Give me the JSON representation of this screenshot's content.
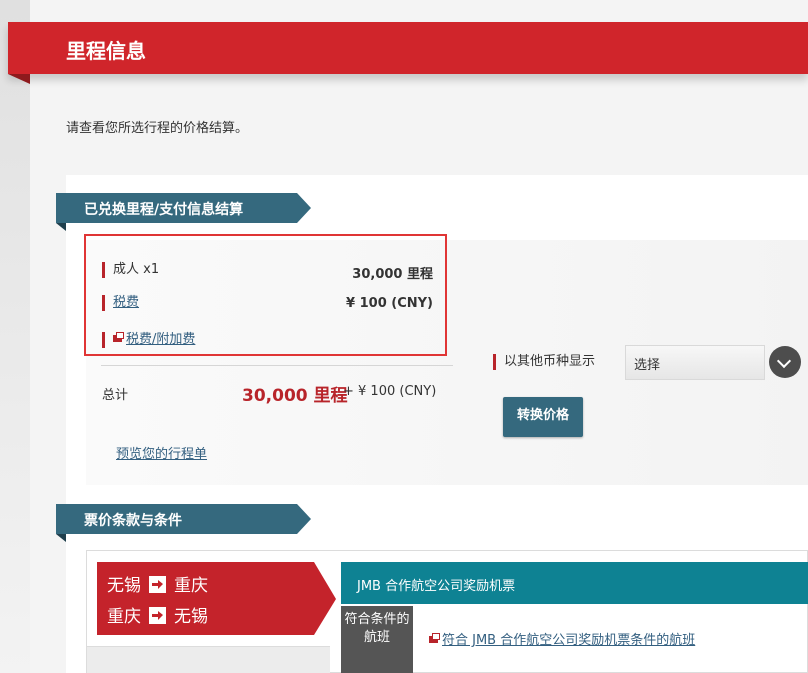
{
  "header": {
    "title": "里程信息"
  },
  "intro_text": "请查看您所选行程的价格结算。",
  "summary": {
    "section_title": "已兑换里程/支付信息结算",
    "rows": [
      {
        "label": "成人 x1",
        "value": "30,000 里程"
      },
      {
        "label": "税费",
        "value": "¥ 100 (CNY)"
      },
      {
        "label": "税费/附加费",
        "value": ""
      }
    ],
    "total_label": "总计",
    "total_miles": "30,000 里程",
    "total_cash": "+ ¥ 100 (CNY)",
    "preview_link": "预览您的行程单",
    "currency": {
      "label": "以其他币种显示",
      "selected": "选择",
      "convert_button": "转换价格"
    }
  },
  "fare_terms": {
    "section_title": "票价条款与条件",
    "routes": [
      {
        "from": "无锡",
        "to": "重庆"
      },
      {
        "from": "重庆",
        "to": "无锡"
      }
    ],
    "fare_name": "JMB 合作航空公司奖励机票",
    "condition_label": "符合条件的航班",
    "condition_link": "符合 JMB 合作航空公司奖励机票条件的航班"
  },
  "colors": {
    "brand_red": "#d0252b",
    "teal": "#0e8293",
    "slate_blue": "#35697e"
  }
}
